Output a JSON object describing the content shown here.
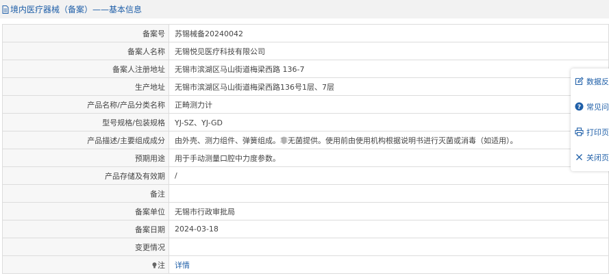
{
  "header": {
    "title": "境内医疗器械（备案）——基本信息",
    "icon": "document-icon"
  },
  "rows": [
    {
      "label": "备案号",
      "value": "苏锡械备20240042"
    },
    {
      "label": "备案人名称",
      "value": "无锡悦见医疗科技有限公司"
    },
    {
      "label": "备案人注册地址",
      "value": "无锡市滨湖区马山街道梅梁西路 136-7"
    },
    {
      "label": "生产地址",
      "value": "无锡市滨湖区马山街道梅梁西路136号1层、7层"
    },
    {
      "label": "产品名称/产品分类名称",
      "value": "正畸测力计"
    },
    {
      "label": "型号规格/包装规格",
      "value": "YJ-SZ、YJ-GD"
    },
    {
      "label": "产品描述/主要组成成分",
      "value": "由外壳、测力组件、弹簧组成。非无菌提供。使用前由使用机构根据说明书进行灭菌或消毒（如适用）。"
    },
    {
      "label": "预期用途",
      "value": "用于手动测量口腔中力度参数。"
    },
    {
      "label": "产品存储及有效期",
      "value": "/"
    },
    {
      "label": "备注",
      "value": ""
    },
    {
      "label": "备案单位",
      "value": "无锡市行政审批局"
    },
    {
      "label": "备案日期",
      "value": "2024-03-18"
    },
    {
      "label": "变更情况",
      "value": ""
    }
  ],
  "note_row": {
    "label": "注",
    "link": "详情",
    "icon": "bulb-icon"
  },
  "side_panel": [
    {
      "label": "数据反馈",
      "icon": "edit-icon"
    },
    {
      "label": "常见问题",
      "icon": "question-icon"
    },
    {
      "label": "打印页面",
      "icon": "print-icon"
    },
    {
      "label": "关闭页面",
      "icon": "close-icon"
    }
  ]
}
